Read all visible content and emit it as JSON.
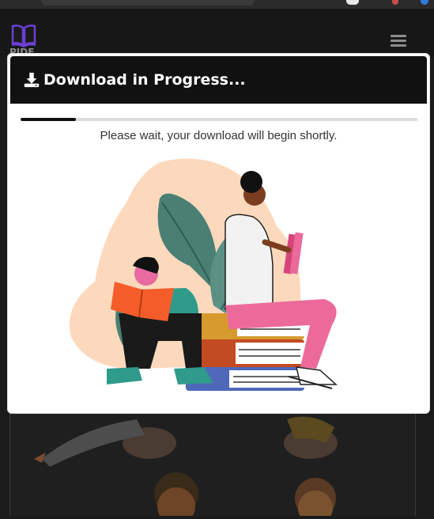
{
  "site": {
    "logo_text": "PIDF",
    "icons": {
      "logo": "open-book-icon",
      "menu": "hamburger-menu-icon"
    }
  },
  "modal": {
    "title": "Download in Progress...",
    "title_icon": "download-icon",
    "message": "Please wait, your download will begin shortly.",
    "progress": 0.14,
    "illustration": "people-reading-books-illustration"
  },
  "colors": {
    "header_bg": "#111111",
    "progress_fill": "#111111",
    "progress_track": "#dcdcdc",
    "page_bg": "#1b1b1b"
  }
}
